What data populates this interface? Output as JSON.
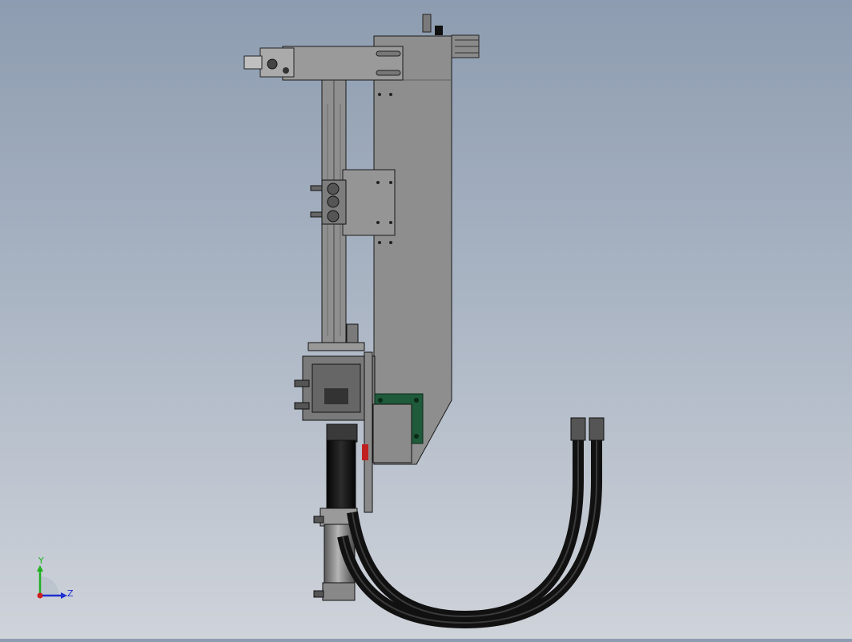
{
  "triad": {
    "y_label": "Y",
    "z_label": "Z",
    "colors": {
      "y": "#1fb01f",
      "z": "#1f2fd0",
      "x": "#d01f1f"
    }
  },
  "model": {
    "colors": {
      "plate": "#8e8e8e",
      "plate_dark": "#6f6f6f",
      "outline": "#1a1a1a",
      "hose": "#111111",
      "motor_green": "#1f5a3a",
      "accent_red": "#c02020"
    }
  }
}
